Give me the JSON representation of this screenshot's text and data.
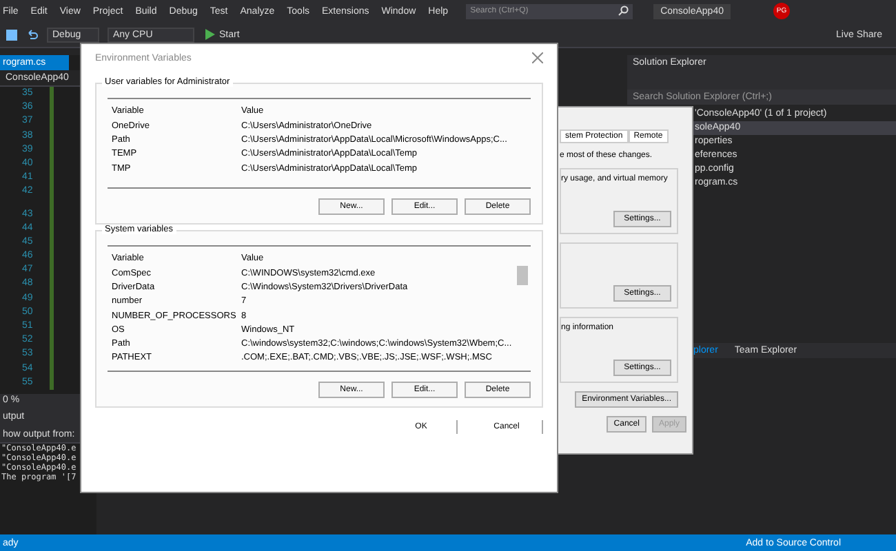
{
  "menu": [
    "File",
    "Edit",
    "View",
    "Project",
    "Build",
    "Debug",
    "Test",
    "Analyze",
    "Tools",
    "Extensions",
    "Window",
    "Help"
  ],
  "search": {
    "placeholder": "Search (Ctrl+Q)"
  },
  "solution_name": "ConsoleApp40",
  "avatar": "PG",
  "toolbar": {
    "configuration": "Debug",
    "platform": "Any CPU",
    "start": "Start",
    "live_share": "Live Share"
  },
  "editor": {
    "tab": "rogram.cs",
    "nav": "ConsoleApp40",
    "line_numbers": [
      "35",
      "36",
      "37",
      "38",
      "39",
      "40",
      "41",
      "42",
      "43",
      "44",
      "45",
      "46",
      "47",
      "48",
      "49",
      "50",
      "51",
      "52",
      "53",
      "54",
      "55"
    ],
    "zoom": "0 %"
  },
  "output": {
    "title": "utput",
    "show_from": "how output from:",
    "lines": [
      "\"ConsoleApp40.e",
      "\"ConsoleApp40.e",
      "\"ConsoleApp40.e",
      "The program '[7"
    ]
  },
  "solution_explorer": {
    "title": "Solution Explorer",
    "search": "Search Solution Explorer (Ctrl+;)",
    "items": [
      {
        "label": "'ConsoleApp40' (1 of 1 project)",
        "selected": false
      },
      {
        "label": "soleApp40",
        "selected": true
      },
      {
        "label": "roperties",
        "selected": false
      },
      {
        "label": "eferences",
        "selected": false
      },
      {
        "label": "pp.config",
        "selected": false
      },
      {
        "label": "rogram.cs",
        "selected": false
      }
    ],
    "tabs": [
      {
        "label": "plorer",
        "selected": true
      },
      {
        "label": "Team Explorer",
        "selected": false
      }
    ]
  },
  "status_bar": {
    "left": "ady",
    "right": "Add to Source Control"
  },
  "system_properties": {
    "tabs": [
      {
        "label": "stem Protection",
        "selected": false
      },
      {
        "label": "Remote",
        "selected": false
      }
    ],
    "note": "e most of these changes.",
    "groups": [
      {
        "text": "ry usage, and virtual memory",
        "button": "Settings..."
      },
      {
        "button": "Settings..."
      },
      {
        "text": "ng information",
        "button": "Settings..."
      }
    ],
    "env_button": "Environment Variables...",
    "buttons": [
      {
        "label": "Cancel",
        "disabled": false
      },
      {
        "label": "Apply",
        "disabled": true
      }
    ]
  },
  "env_dialog": {
    "title": "Environment Variables",
    "user": {
      "label": "User variables for Administrator",
      "columns": [
        "Variable",
        "Value"
      ],
      "rows": [
        [
          "OneDrive",
          "C:\\Users\\Administrator\\OneDrive"
        ],
        [
          "Path",
          "C:\\Users\\Administrator\\AppData\\Local\\Microsoft\\WindowsApps;C..."
        ],
        [
          "TEMP",
          "C:\\Users\\Administrator\\AppData\\Local\\Temp"
        ],
        [
          "TMP",
          "C:\\Users\\Administrator\\AppData\\Local\\Temp"
        ]
      ],
      "buttons": [
        "New...",
        "Edit...",
        "Delete"
      ]
    },
    "system": {
      "label": "System variables",
      "columns": [
        "Variable",
        "Value"
      ],
      "rows": [
        [
          "ComSpec",
          "C:\\WINDOWS\\system32\\cmd.exe"
        ],
        [
          "DriverData",
          "C:\\Windows\\System32\\Drivers\\DriverData"
        ],
        [
          "number",
          "7"
        ],
        [
          "NUMBER_OF_PROCESSORS",
          "8"
        ],
        [
          "OS",
          "Windows_NT"
        ],
        [
          "Path",
          "C:\\windows\\system32;C:\\windows;C:\\windows\\System32\\Wbem;C..."
        ],
        [
          "PATHEXT",
          ".COM;.EXE;.BAT;.CMD;.VBS;.VBE;.JS;.JSE;.WSF;.WSH;.MSC"
        ]
      ],
      "buttons": [
        "New...",
        "Edit...",
        "Delete"
      ]
    },
    "buttons": [
      "OK",
      "Cancel"
    ]
  }
}
